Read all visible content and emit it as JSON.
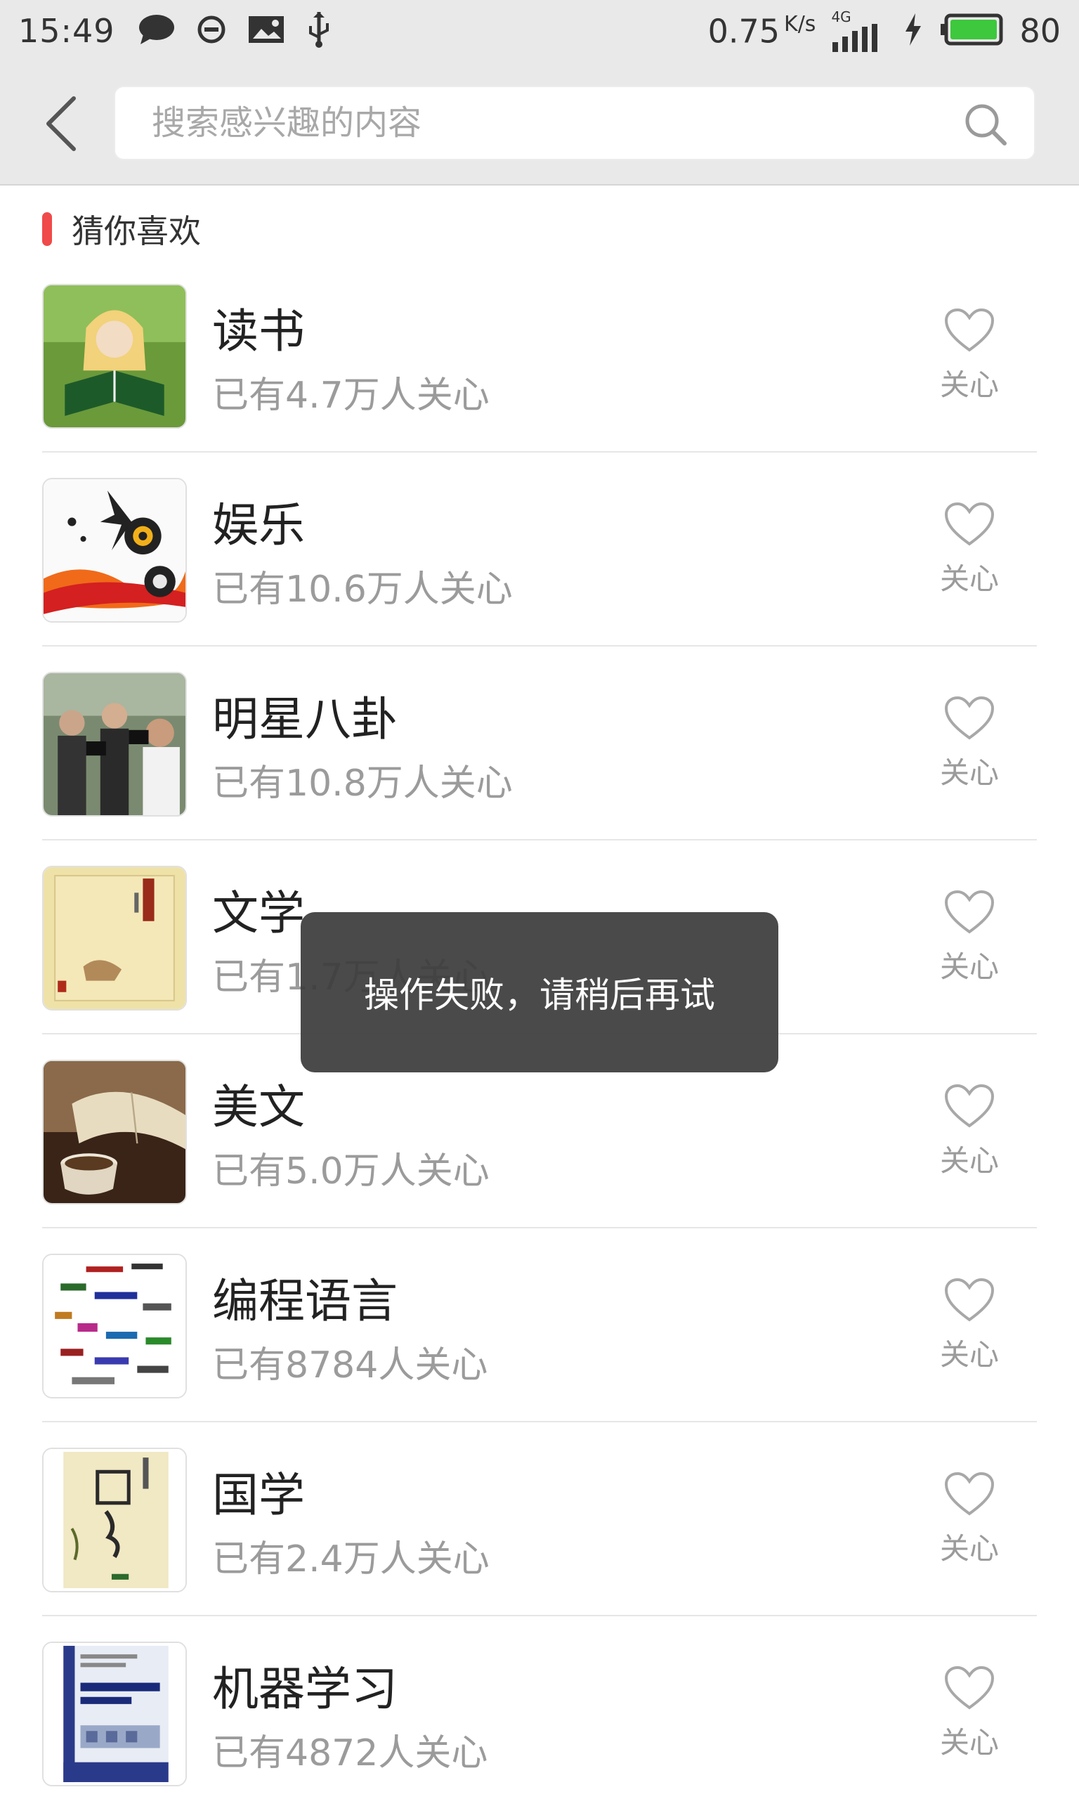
{
  "status_bar": {
    "time": "15:49",
    "speed": "0.75",
    "speed_unit": "K/s",
    "network": "4G",
    "battery": "80",
    "icons": [
      "message-icon",
      "circle-minus-icon",
      "image-icon",
      "usb-icon",
      "signal-icon",
      "charging-icon",
      "battery-icon"
    ]
  },
  "header": {
    "back_icon": "back-arrow-icon",
    "search_placeholder": "搜索感兴趣的内容",
    "search_icon": "search-icon"
  },
  "section": {
    "title": "猜你喜欢",
    "accent_color": "#f04a4a"
  },
  "items": [
    {
      "title": "读书",
      "subtitle": "已有4.7万人关心",
      "follow_label": "关心",
      "thumb": "reading-girl-image"
    },
    {
      "title": "娱乐",
      "subtitle": "已有10.6万人关心",
      "follow_label": "关心",
      "thumb": "music-speakers-image"
    },
    {
      "title": "明星八卦",
      "subtitle": "已有10.8万人关心",
      "follow_label": "关心",
      "thumb": "paparazzi-image"
    },
    {
      "title": "文学",
      "subtitle": "已有1.7万人关心",
      "follow_label": "关心",
      "thumb": "book-cover-image"
    },
    {
      "title": "美文",
      "subtitle": "已有5.0万人关心",
      "follow_label": "关心",
      "thumb": "book-and-tea-image"
    },
    {
      "title": "编程语言",
      "subtitle": "已有8784人关心",
      "follow_label": "关心",
      "thumb": "programming-words-image"
    },
    {
      "title": "国学",
      "subtitle": "已有2.4万人关心",
      "follow_label": "关心",
      "thumb": "guoxue-cover-image"
    },
    {
      "title": "机器学习",
      "subtitle": "已有4872人关心",
      "follow_label": "关心",
      "thumb": "machine-learning-book-image"
    }
  ],
  "toast": {
    "message": "操作失败，请稍后再试"
  }
}
